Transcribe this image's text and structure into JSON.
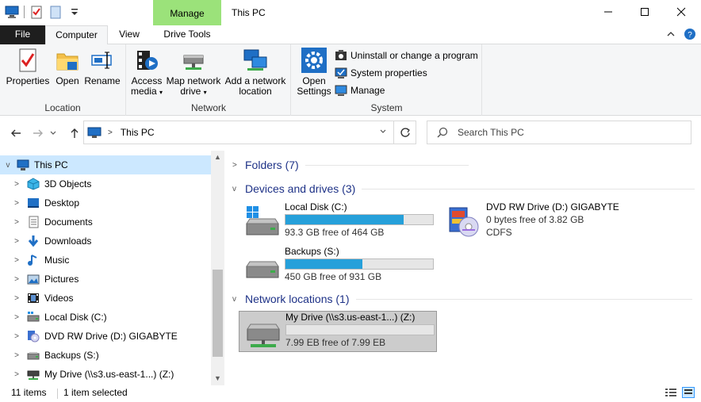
{
  "window": {
    "title": "This PC",
    "context_tab_group": "Manage",
    "accent_context": "#9be27a"
  },
  "tabs": {
    "file": "File",
    "computer": "Computer",
    "view": "View",
    "drive_tools": "Drive Tools"
  },
  "ribbon": {
    "location": {
      "label": "Location",
      "properties": "Properties",
      "open": "Open",
      "rename": "Rename"
    },
    "network": {
      "label": "Network",
      "access_media_line1": "Access",
      "access_media_line2": "media",
      "map_drive_line1": "Map network",
      "map_drive_line2": "drive",
      "add_location_line1": "Add a network",
      "add_location_line2": "location"
    },
    "system": {
      "label": "System",
      "open_settings_line1": "Open",
      "open_settings_line2": "Settings",
      "uninstall": "Uninstall or change a program",
      "system_properties": "System properties",
      "manage": "Manage"
    }
  },
  "address": {
    "path_item": "This PC",
    "search_placeholder": "Search This PC"
  },
  "nav_pane": {
    "items": [
      {
        "label": "This PC",
        "icon": "pc-icon"
      },
      {
        "label": "3D Objects",
        "icon": "3d-objects-icon"
      },
      {
        "label": "Desktop",
        "icon": "desktop-icon"
      },
      {
        "label": "Documents",
        "icon": "documents-icon"
      },
      {
        "label": "Downloads",
        "icon": "downloads-icon"
      },
      {
        "label": "Music",
        "icon": "music-icon"
      },
      {
        "label": "Pictures",
        "icon": "pictures-icon"
      },
      {
        "label": "Videos",
        "icon": "videos-icon"
      },
      {
        "label": "Local Disk (C:)",
        "icon": "local-disk-icon"
      },
      {
        "label": "DVD RW Drive (D:) GIGABYTE",
        "icon": "dvd-drive-icon"
      },
      {
        "label": "Backups (S:)",
        "icon": "drive-icon"
      },
      {
        "label": "My Drive (\\\\s3.us-east-1...) (Z:)",
        "icon": "network-drive-icon"
      }
    ]
  },
  "content": {
    "folders_header": "Folders (7)",
    "devices_header": "Devices and drives (3)",
    "network_header": "Network locations (1)",
    "drives": {
      "c": {
        "name": "Local Disk (C:)",
        "free": "93.3 GB free of 464 GB",
        "used_fraction": 0.8
      },
      "d": {
        "name": "DVD RW Drive (D:) GIGABYTE",
        "free": "0 bytes free of 3.82 GB",
        "fs": "CDFS"
      },
      "s": {
        "name": "Backups (S:)",
        "free": "450 GB free of 931 GB",
        "used_fraction": 0.52
      },
      "z": {
        "name": "My Drive (\\\\s3.us-east-1...) (Z:)",
        "free": "7.99 EB free of 7.99 EB",
        "used_fraction": 0.0
      }
    },
    "bar_color": "#26a0da"
  },
  "status": {
    "items_count": "11 items",
    "selected": "1 item selected"
  }
}
